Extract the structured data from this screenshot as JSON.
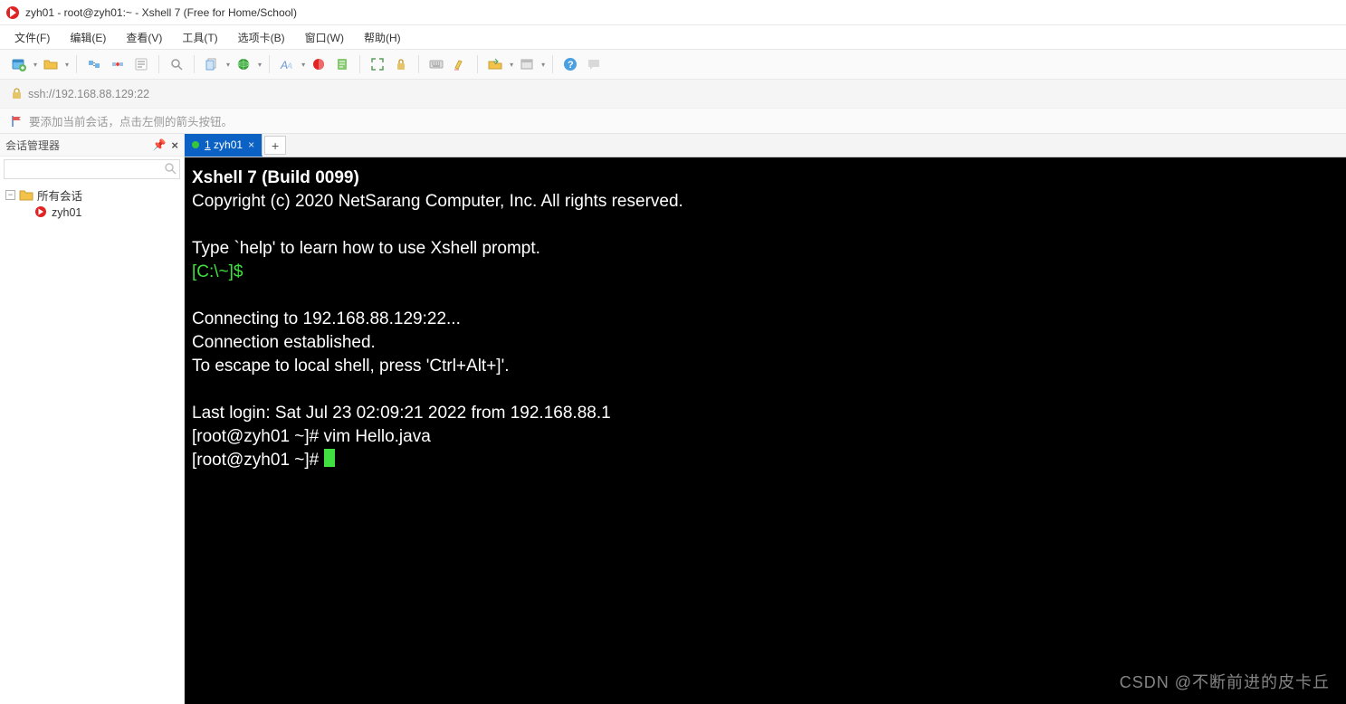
{
  "title": "zyh01 - root@zyh01:~ - Xshell 7 (Free for Home/School)",
  "menus": {
    "file": "文件(F)",
    "edit": "编辑(E)",
    "view": "查看(V)",
    "tools": "工具(T)",
    "tabs": "选项卡(B)",
    "window": "窗口(W)",
    "help": "帮助(H)"
  },
  "address": "ssh://192.168.88.129:22",
  "hint": "要添加当前会话，点击左侧的箭头按钮。",
  "sidebar": {
    "title": "会话管理器",
    "search_placeholder": "",
    "root": "所有会话",
    "item": "zyh01"
  },
  "tab": {
    "index": "1",
    "name": "zyh01"
  },
  "addtab_label": "+",
  "terminal": {
    "line1": "Xshell 7 (Build 0099)",
    "line2": "Copyright (c) 2020 NetSarang Computer, Inc. All rights reserved.",
    "blank": "",
    "line3": "Type `help' to learn how to use Xshell prompt.",
    "prompt_local": "[C:\\~]$",
    "line4": "Connecting to 192.168.88.129:22...",
    "line5": "Connection established.",
    "line6": "To escape to local shell, press 'Ctrl+Alt+]'.",
    "line7": "Last login: Sat Jul 23 02:09:21 2022 from 192.168.88.1",
    "line8": "[root@zyh01 ~]# vim Hello.java",
    "line9": "[root@zyh01 ~]# "
  },
  "watermark": "CSDN @不断前进的皮卡丘"
}
